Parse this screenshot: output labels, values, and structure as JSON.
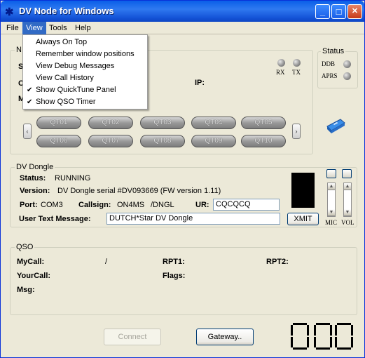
{
  "window": {
    "title": "DV Node for Windows",
    "icon": "app-star-icon",
    "controls": {
      "minimize": "_",
      "maximize": "□",
      "close": "✕"
    }
  },
  "menubar": {
    "items": [
      "File",
      "View",
      "Tools",
      "Help"
    ]
  },
  "view_menu": {
    "items": [
      {
        "label": "Always On Top",
        "checked": false
      },
      {
        "label": "Remember window positions",
        "checked": false
      },
      {
        "label": "View Debug Messages",
        "checked": false
      },
      {
        "label": "View Call History",
        "checked": false
      },
      {
        "label": "Show QuickTune Panel",
        "checked": true
      },
      {
        "label": "Show QSO Timer",
        "checked": true
      }
    ],
    "check_glyph": "✔"
  },
  "node": {
    "legend": "N",
    "s_label": "S",
    "c_label": "C",
    "m_label": "M",
    "ip_label": "IP:",
    "rx": "RX",
    "tx": "TX"
  },
  "status": {
    "legend": "Status",
    "ddb": "DDB",
    "aprs": "APRS"
  },
  "quicktune": {
    "buttons": [
      "QT01",
      "QT02",
      "QT03",
      "QT04",
      "QT05",
      "QT06",
      "QT07",
      "QT08",
      "QT09",
      "QT10"
    ],
    "left": "‹",
    "right": "›"
  },
  "dongle": {
    "legend": "DV Dongle",
    "status_label": "Status:",
    "status_value": "RUNNING",
    "version_label": "Version:",
    "version_value": "DV Dongle serial #DV093669 (FW version 1.11)",
    "port_label": "Port:",
    "port_value": "COM3",
    "callsign_label": "Callsign:",
    "callsign_value": "ON4MS",
    "callsign_suffix": "/DNGL",
    "ur_label": "UR:",
    "ur_value": "CQCQCQ",
    "msg_label": "User Text Message:",
    "msg_value": "DUTCH*Star DV Dongle",
    "xmit": "XMIT",
    "mic": "MIC",
    "vol": "VOL"
  },
  "qso": {
    "legend": "QSO",
    "mycall_label": "MyCall:",
    "mycall_sep": "/",
    "rpt1_label": "RPT1:",
    "rpt2_label": "RPT2:",
    "yourcall_label": "YourCall:",
    "flags_label": "Flags:",
    "msg_label": "Msg:"
  },
  "footer": {
    "connect": "Connect",
    "gateway": "Gateway..",
    "timer": "000"
  },
  "colors": {
    "titlebar": "#0a5fe8",
    "menu_highlight": "#316ac5",
    "window_bg": "#ece9d8"
  }
}
